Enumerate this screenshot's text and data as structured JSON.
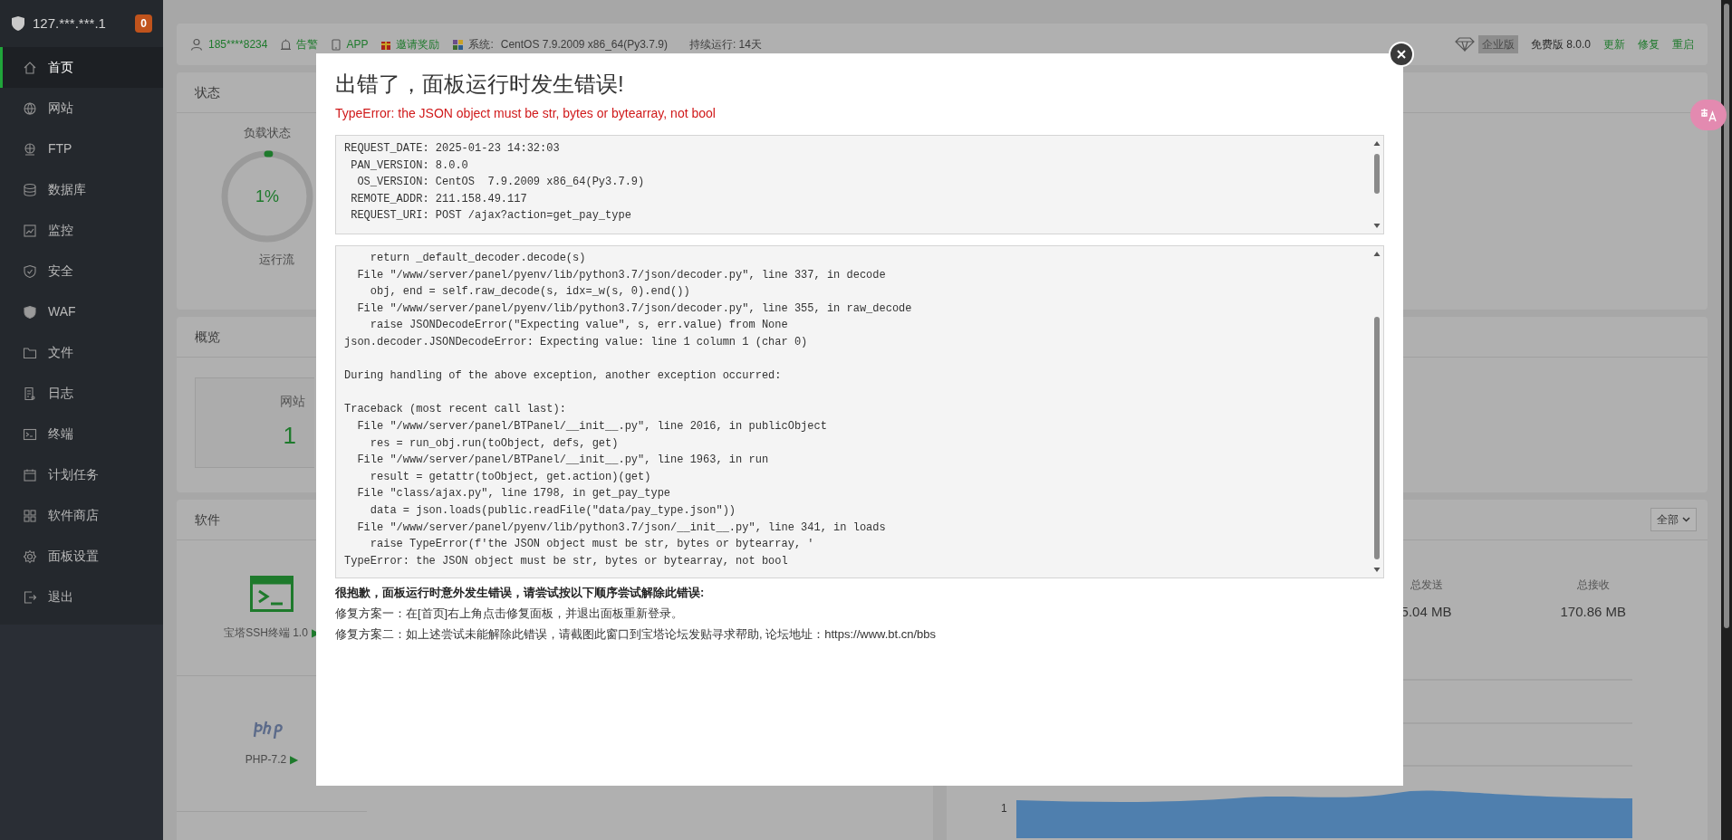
{
  "sidebar": {
    "host": "127.***.***.1",
    "badge": "0",
    "items": [
      {
        "label": "首页",
        "selected": true
      },
      {
        "label": "网站",
        "selected": false
      },
      {
        "label": "FTP",
        "selected": false
      },
      {
        "label": "数据库",
        "selected": false
      },
      {
        "label": "监控",
        "selected": false
      },
      {
        "label": "安全",
        "selected": false
      },
      {
        "label": "WAF",
        "selected": false
      },
      {
        "label": "文件",
        "selected": false
      },
      {
        "label": "日志",
        "selected": false
      },
      {
        "label": "终端",
        "selected": false
      },
      {
        "label": "计划任务",
        "selected": false
      },
      {
        "label": "软件商店",
        "selected": false
      },
      {
        "label": "面板设置",
        "selected": false
      },
      {
        "label": "退出",
        "selected": false
      }
    ]
  },
  "header": {
    "user": "185****8234",
    "alarm": "告警",
    "app": "APP",
    "invite": "邀请奖励",
    "system_label": "系统:",
    "system": "CentOS 7.9.2009 x86_64(Py3.7.9)",
    "uptime": "持续运行: 14天",
    "edition": "企业版",
    "version": "免费版 8.0.0",
    "actions": [
      "更新",
      "修复",
      "重启"
    ]
  },
  "status_card": {
    "title": "状态",
    "load_label": "负载状态",
    "load_value": "1%",
    "gauge": {
      "level": 0.01
    },
    "load_caption": "运行流"
  },
  "overview_card": {
    "title": "概览",
    "site_label": "网站",
    "site_count": "1"
  },
  "software_card": {
    "title": "软件",
    "items": [
      {
        "kind": "terminal",
        "label": "宝塔SSH终端 1.0",
        "play": "▶"
      },
      {
        "kind": "php",
        "label": "PHP-7.2",
        "play": "▶"
      }
    ]
  },
  "traffic_card": {
    "filter": "全部",
    "stats": [
      {
        "label": "总发送",
        "value": "5.04 MB"
      },
      {
        "label": "总接收",
        "value": "170.86 MB"
      }
    ],
    "y_tick": "1"
  },
  "error_dialog": {
    "title": "出错了，面板运行时发生错误!",
    "error": "TypeError: the JSON object must be str, bytes or bytearray, not bool",
    "request_info": "REQUEST_DATE: 2025-01-23 14:32:03\n PAN_VERSION: 8.0.0\n  OS_VERSION: CentOS  7.9.2009 x86_64(Py3.7.9)\n REMOTE_ADDR: 211.158.49.117\n REQUEST_URI: POST /ajax?action=get_pay_type",
    "traceback": "    return _default_decoder.decode(s)\n  File \"/www/server/panel/pyenv/lib/python3.7/json/decoder.py\", line 337, in decode\n    obj, end = self.raw_decode(s, idx=_w(s, 0).end())\n  File \"/www/server/panel/pyenv/lib/python3.7/json/decoder.py\", line 355, in raw_decode\n    raise JSONDecodeError(\"Expecting value\", s, err.value) from None\njson.decoder.JSONDecodeError: Expecting value: line 1 column 1 (char 0)\n\nDuring handling of the above exception, another exception occurred:\n\nTraceback (most recent call last):\n  File \"/www/server/panel/BTPanel/__init__.py\", line 2016, in publicObject\n    res = run_obj.run(toObject, defs, get)\n  File \"/www/server/panel/BTPanel/__init__.py\", line 1963, in run\n    result = getattr(toObject, get.action)(get)\n  File \"class/ajax.py\", line 1798, in get_pay_type\n    data = json.loads(public.readFile(\"data/pay_type.json\"))\n  File \"/www/server/panel/pyenv/lib/python3.7/json/__init__.py\", line 341, in loads\n    raise TypeError(f'the JSON object must be str, bytes or bytearray, '\nTypeError: the JSON object must be str, bytes or bytearray, not bool",
    "help_title": "很抱歉，面板运行时意外发生错误，请尝试按以下顺序尝试解除此错误:",
    "fixes": [
      "修复方案一：在[首页]右上角点击修复面板，并退出面板重新登录。",
      "修复方案二：如上述尝试未能解除此错误，请截图此窗口到宝塔论坛发贴寻求帮助, 论坛地址：https://www.bt.cn/bbs"
    ]
  }
}
